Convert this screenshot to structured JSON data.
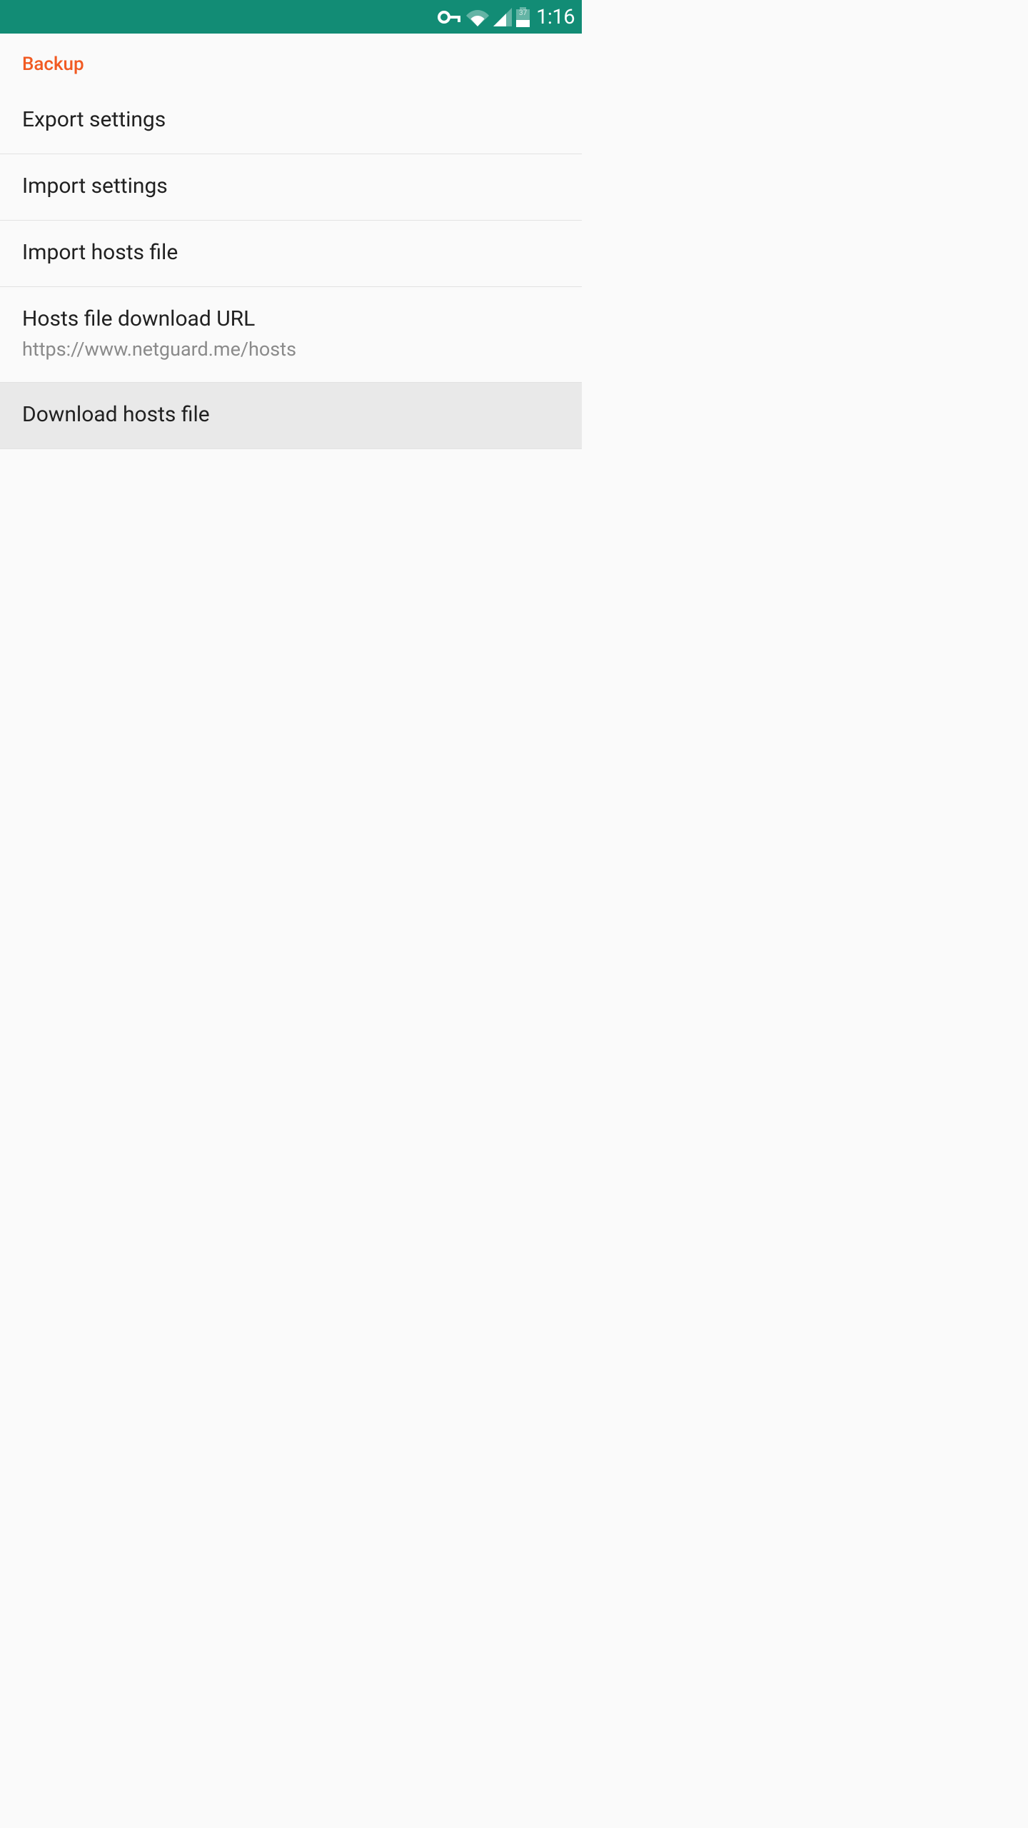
{
  "status_bar": {
    "time": "1:16",
    "battery_text": "37"
  },
  "section": {
    "header": "Backup",
    "items": [
      {
        "title": "Export settings",
        "subtitle": null,
        "selected": false
      },
      {
        "title": "Import settings",
        "subtitle": null,
        "selected": false
      },
      {
        "title": "Import hosts file",
        "subtitle": null,
        "selected": false
      },
      {
        "title": "Hosts file download URL",
        "subtitle": "https://www.netguard.me/hosts",
        "selected": false
      },
      {
        "title": "Download hosts file",
        "subtitle": null,
        "selected": true
      }
    ]
  }
}
